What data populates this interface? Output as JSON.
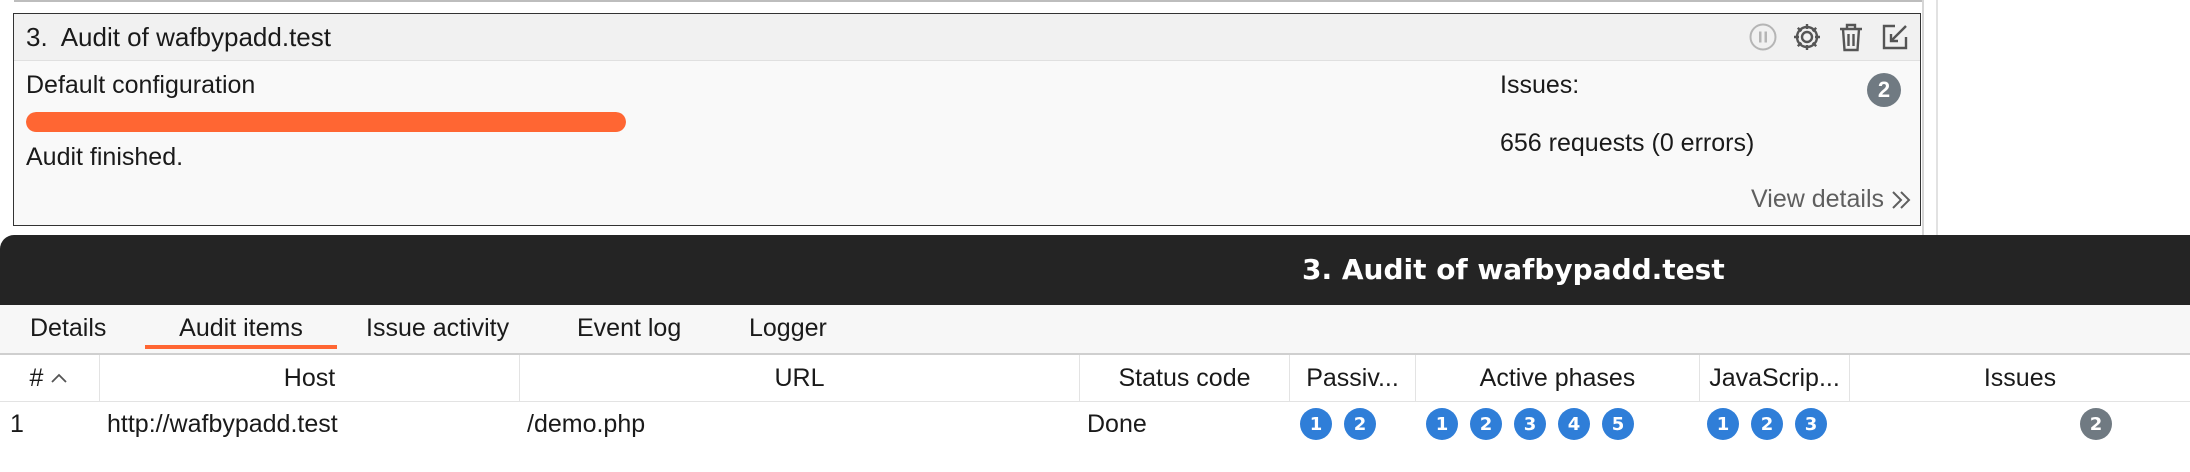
{
  "task": {
    "title": "3.  Audit of wafbypadd.test",
    "configuration": "Default configuration",
    "progress_percent": 100,
    "status": "Audit finished.",
    "issues_label": "Issues:",
    "issues_count": "2",
    "requests": "656 requests (0 errors)",
    "view_details": "View details",
    "icons": [
      "pause-icon",
      "gear-icon",
      "trash-icon",
      "edit-icon"
    ]
  },
  "panel": {
    "title": "3. Audit of wafbypadd.test",
    "tabs": [
      {
        "label": "Details",
        "active": false
      },
      {
        "label": "Audit items",
        "active": true
      },
      {
        "label": "Issue activity",
        "active": false
      },
      {
        "label": "Event log",
        "active": false
      },
      {
        "label": "Logger",
        "active": false
      }
    ],
    "columns": [
      "#",
      "Host",
      "URL",
      "Status code",
      "Passiv...",
      "Active phases",
      "JavaScrip...",
      "Issues"
    ],
    "rows": [
      {
        "num": "1",
        "host": "http://wafbypadd.test",
        "url": "/demo.php",
        "status": "Done",
        "passive": [
          "1",
          "2"
        ],
        "active": [
          "1",
          "2",
          "3",
          "4",
          "5"
        ],
        "javascript": [
          "1",
          "2",
          "3"
        ],
        "issues": "2"
      }
    ]
  },
  "colors": {
    "accent": "#ff6633",
    "badge_blue": "#2f7ed8",
    "badge_gray": "#707a82",
    "titlebar": "#242424"
  }
}
